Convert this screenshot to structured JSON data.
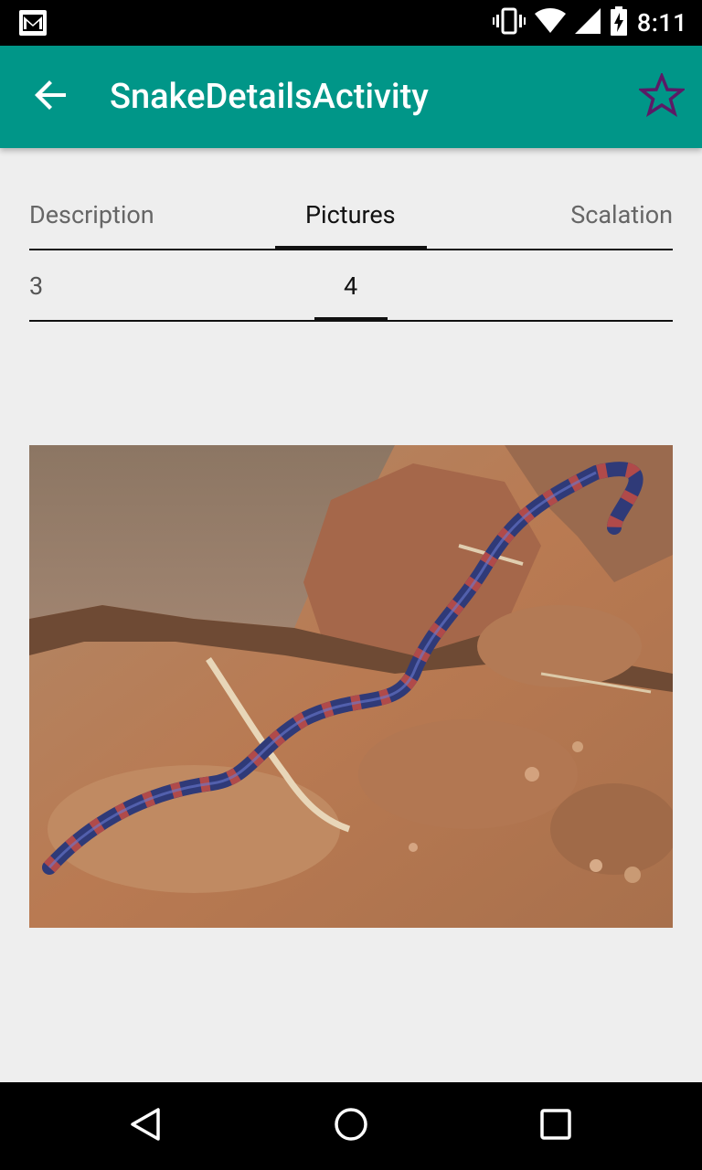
{
  "status_bar": {
    "time": "8:11",
    "icons": [
      "gmail-icon",
      "vibrate-icon",
      "wifi-icon",
      "signal-icon",
      "battery-charging-icon"
    ]
  },
  "app_bar": {
    "title": "SnakeDetailsActivity",
    "back_icon": "arrow-left-icon",
    "favorite_icon": "star-outline-icon",
    "favorite_color": "#5c1a66",
    "background_color": "#009688"
  },
  "tabs": [
    {
      "label": "Description",
      "active": false
    },
    {
      "label": "Pictures",
      "active": true
    },
    {
      "label": "Scalation",
      "active": false
    }
  ],
  "pager": {
    "pages": [
      "3",
      "4"
    ],
    "current": "4"
  },
  "picture": {
    "icon": "snake-photo"
  },
  "nav_bar": {
    "icons": [
      "nav-back-icon",
      "nav-home-icon",
      "nav-recents-icon"
    ]
  }
}
